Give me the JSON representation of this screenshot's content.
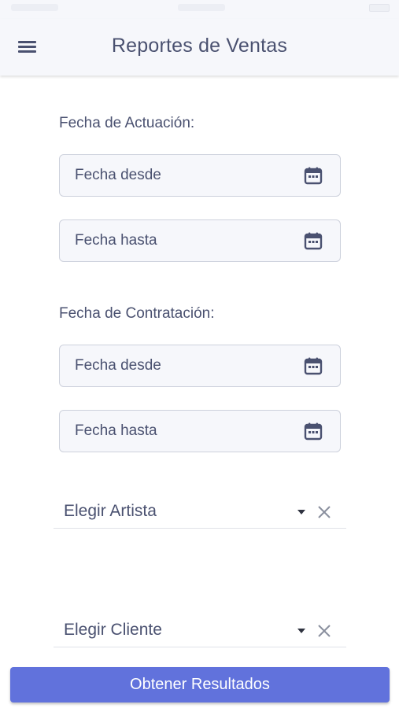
{
  "app_bar": {
    "title": "Reportes de Ventas",
    "menu_icon": "hamburger-menu-icon"
  },
  "sections": [
    {
      "label": "Fecha de Actuación:",
      "from_placeholder": "Fecha desde",
      "to_placeholder": "Fecha hasta"
    },
    {
      "label": "Fecha de Contratación:",
      "from_placeholder": "Fecha desde",
      "to_placeholder": "Fecha hasta"
    }
  ],
  "selects": {
    "artist": {
      "label": "Elegir Artista"
    },
    "client": {
      "label": "Elegir Cliente"
    }
  },
  "icons": {
    "date": "calendar-icon",
    "dropdown": "caret-down-icon",
    "clear": "close-icon"
  },
  "submit_label": "Obtener Resultados",
  "colors": {
    "accent": "#6172dc",
    "text": "#4a5170",
    "field_bg": "#f6f7fb",
    "field_border": "#cdd1dc"
  }
}
